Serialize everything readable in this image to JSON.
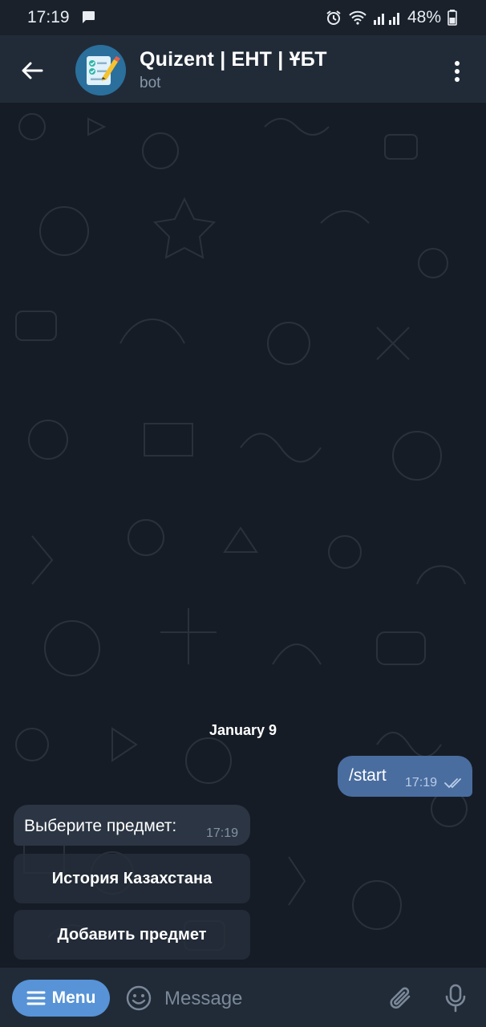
{
  "status_bar": {
    "time": "17:19",
    "battery": "48%"
  },
  "header": {
    "title": "Quizent | ЕНТ | ҰБТ",
    "subtitle": "bot"
  },
  "chat": {
    "date_label": "January 9",
    "messages": [
      {
        "direction": "outgoing",
        "text": "/start",
        "time": "17:19",
        "status": "read"
      },
      {
        "direction": "incoming",
        "text": "Выберите предмет:",
        "time": "17:19"
      }
    ],
    "inline_keyboard": [
      {
        "label": "История Казахстана"
      },
      {
        "label": "Добавить предмет"
      }
    ]
  },
  "composer": {
    "menu_label": "Menu",
    "placeholder": "Message"
  },
  "colors": {
    "accent": "#5793d6",
    "outgoing_bubble": "#4a6da0",
    "incoming_bubble": "#2b3543",
    "header_bg": "#212b38",
    "chat_bg": "#161c26"
  },
  "icons": [
    "back-arrow-icon",
    "kebab-menu-icon",
    "emoji-icon",
    "attach-icon",
    "mic-icon",
    "double-check-icon",
    "hamburger-icon"
  ]
}
